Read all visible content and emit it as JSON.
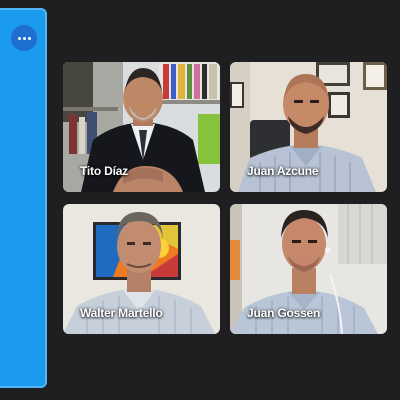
{
  "app": {
    "more_icon": "ellipsis-icon",
    "accent_color": "#1a9bef"
  },
  "participants": [
    {
      "name": "Tito Díaz"
    },
    {
      "name": "Juan Azcune"
    },
    {
      "name": "Walter Martello"
    },
    {
      "name": "Juan Gossen"
    }
  ]
}
